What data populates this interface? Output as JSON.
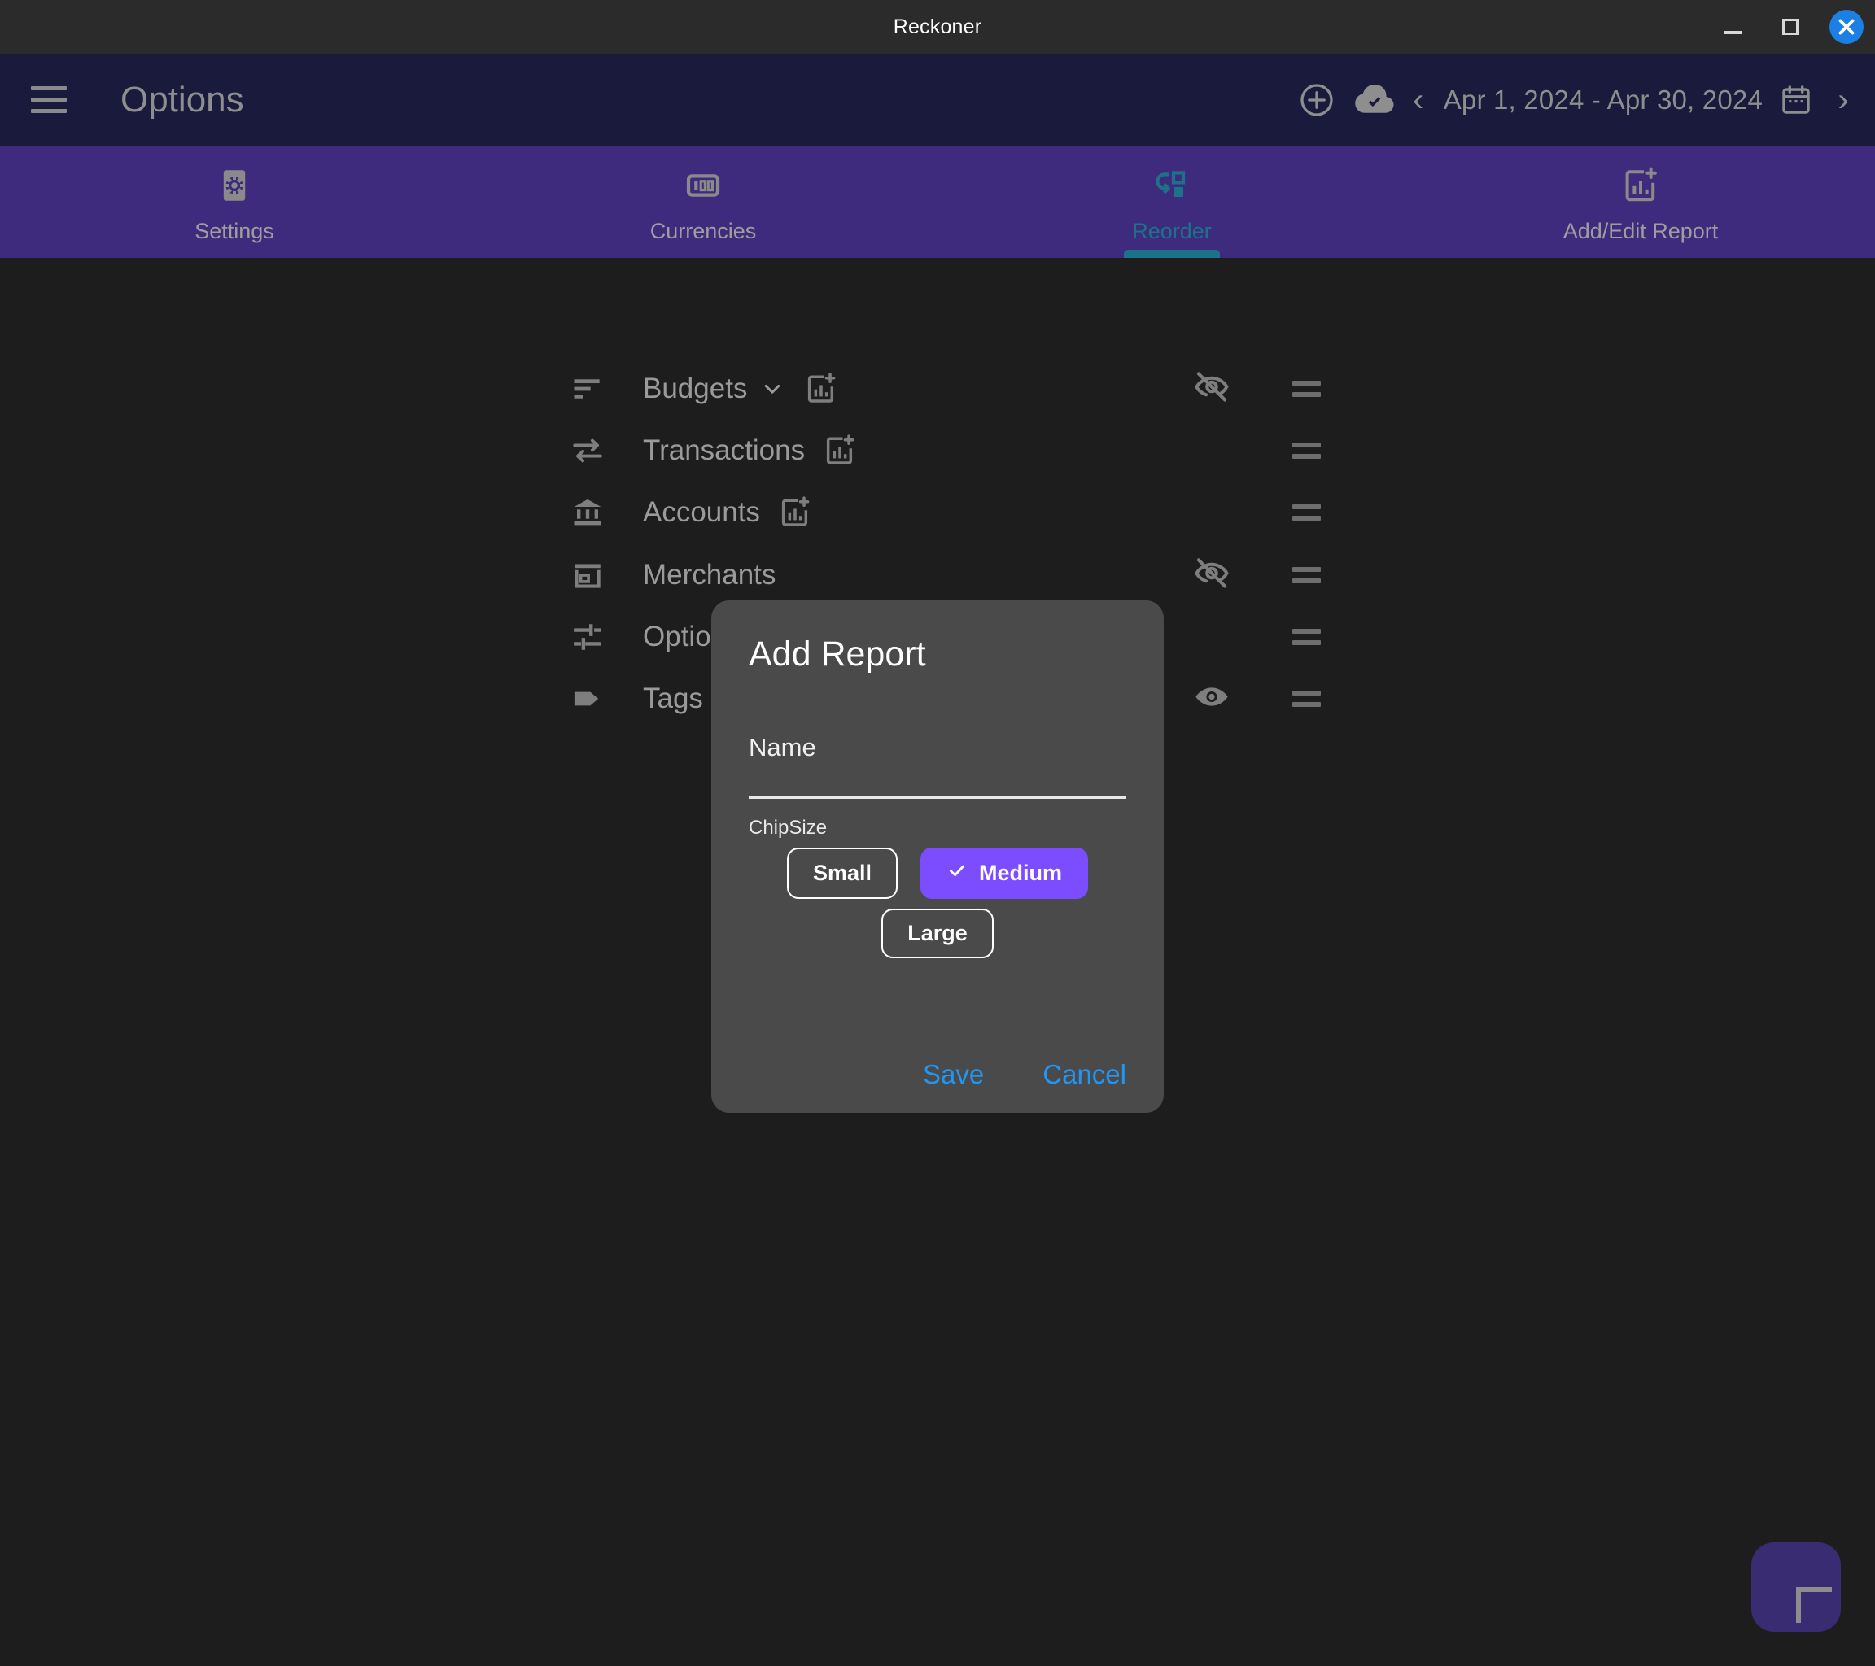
{
  "window": {
    "title": "Reckoner",
    "controls": {
      "minimize": "minimize-button",
      "maximize": "maximize-button",
      "close": "close-button"
    }
  },
  "appbar": {
    "menu_icon": "hamburger-menu-icon",
    "title": "Options",
    "add_icon": "plus-circle-icon",
    "sync_icon": "cloud-check-icon",
    "prev_label": "‹",
    "date_range": "Apr 1, 2024 - Apr 30, 2024",
    "calendar_icon": "calendar-icon",
    "next_label": "›"
  },
  "tabs": [
    {
      "label": "Settings",
      "icon": "gear-icon",
      "active": false
    },
    {
      "label": "Currencies",
      "icon": "banknote-100-icon",
      "active": false
    },
    {
      "label": "Reorder",
      "icon": "reorder-icon",
      "active": true
    },
    {
      "label": "Add/Edit Report",
      "icon": "add-chart-icon",
      "active": false
    }
  ],
  "reorder_rows": [
    {
      "label": "Budgets",
      "icon": "sort-lines-icon",
      "chevron": true,
      "add_chart": true,
      "eye": "hidden"
    },
    {
      "label": "Transactions",
      "icon": "transfer-icon",
      "chevron": false,
      "add_chart": true,
      "eye": "none"
    },
    {
      "label": "Accounts",
      "icon": "bank-icon",
      "chevron": false,
      "add_chart": true,
      "eye": "none"
    },
    {
      "label": "Merchants",
      "icon": "store-icon",
      "chevron": false,
      "add_chart": false,
      "eye": "hidden"
    },
    {
      "label": "Options",
      "icon": "sliders-icon",
      "chevron": false,
      "add_chart": false,
      "eye": "none"
    },
    {
      "label": "Tags",
      "icon": "tag-icon",
      "chevron": false,
      "add_chart": false,
      "eye": "visible"
    }
  ],
  "fab": {
    "icon": "plus-icon",
    "label": "+"
  },
  "dialog": {
    "title": "Add Report",
    "name_label": "Name",
    "name_value": "",
    "name_placeholder": "",
    "chipsize_label": "ChipSize",
    "chips": [
      {
        "label": "Small",
        "selected": false
      },
      {
        "label": "Medium",
        "selected": true
      },
      {
        "label": "Large",
        "selected": false
      }
    ],
    "save_label": "Save",
    "cancel_label": "Cancel"
  },
  "colors": {
    "titlebar": "#2b2b2b",
    "appbar": "#191a3c",
    "tabbar": "#3f2b7d",
    "background": "#1d1d1d",
    "accent_active_tab": "#1b7289",
    "dialog_bg": "#4a4a4a",
    "chip_selected": "#7c4dff",
    "dialog_action": "#2196f3",
    "close_button": "#1b7fe3",
    "fab": "#3a2c72"
  }
}
